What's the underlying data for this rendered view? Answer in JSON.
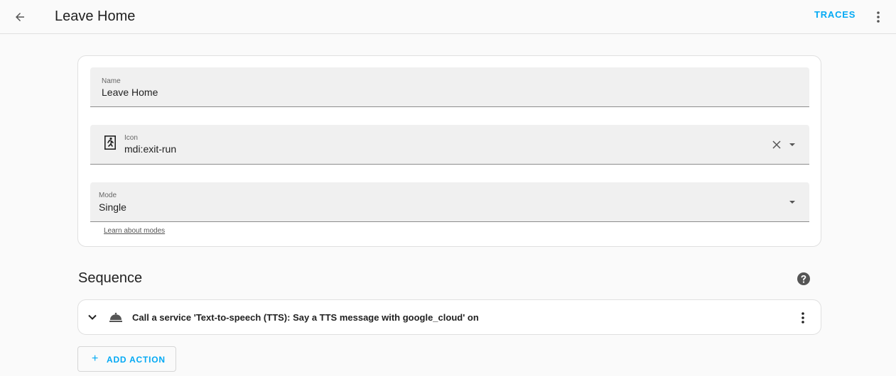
{
  "header": {
    "title": "Leave Home",
    "traces_label": "TRACES",
    "back_icon": "arrow-left-icon",
    "menu_icon": "dots-vertical-icon"
  },
  "form": {
    "name": {
      "label": "Name",
      "value": "Leave Home"
    },
    "icon": {
      "label": "Icon",
      "value": "mdi:exit-run",
      "icon": "exit-run-icon"
    },
    "mode": {
      "label": "Mode",
      "value": "Single"
    },
    "learn_link": "Learn about modes"
  },
  "sequence": {
    "title": "Sequence",
    "actions": [
      {
        "label": "Call a service 'Text-to-speech (TTS): Say a TTS message with google_cloud' on",
        "icon": "room-service-icon"
      }
    ],
    "add_label": "ADD ACTION"
  },
  "colors": {
    "accent": "#03a9f4",
    "field_bg": "#f0f0f0",
    "page_bg": "#fafafa"
  }
}
